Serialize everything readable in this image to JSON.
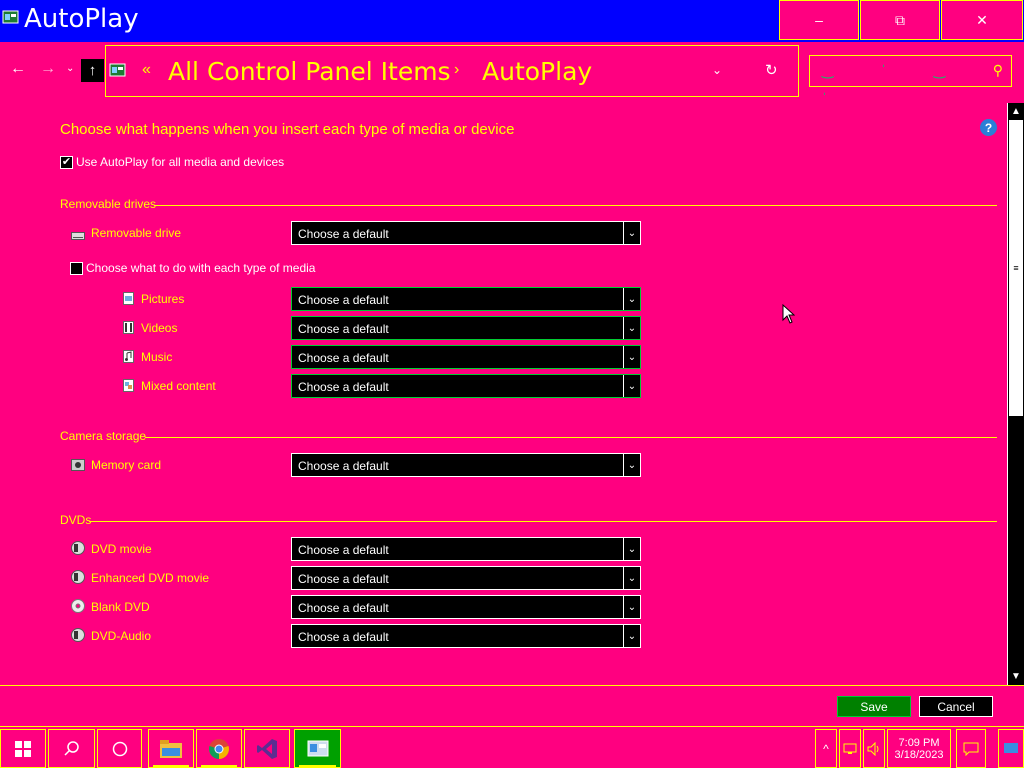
{
  "window": {
    "title": "AutoPlay",
    "minimize": "–",
    "maximize": "⧉",
    "close": "✕"
  },
  "nav": {
    "back": "←",
    "forward": "→",
    "recent": "⌄",
    "up": "↑",
    "chevron": "«",
    "crumbs": [
      "All Control Panel Items",
      "AutoPlay"
    ],
    "separator": "›",
    "dropdown": "⌄",
    "refresh": "↻",
    "search_icon": "⚲"
  },
  "content": {
    "heading": "Choose what happens when you insert each type of media or device",
    "help": "?",
    "use_autoplay": {
      "label": "Use AutoPlay for all media and devices",
      "checked": true,
      "mark": "✔"
    },
    "sections": {
      "removable": {
        "title": "Removable drives"
      },
      "camera": {
        "title": "Camera storage"
      },
      "dvds": {
        "title": "DVDs"
      }
    },
    "removable_drive": {
      "label": "Removable drive",
      "value": "Choose a default"
    },
    "each_media": {
      "label": "Choose what to do with each type of media",
      "checked": false
    },
    "media": [
      {
        "label": "Pictures",
        "value": "Choose a default",
        "icon": "pictures-icon"
      },
      {
        "label": "Videos",
        "value": "Choose a default",
        "icon": "videos-icon"
      },
      {
        "label": "Music",
        "value": "Choose a default",
        "icon": "music-icon"
      },
      {
        "label": "Mixed content",
        "value": "Choose a default",
        "icon": "mixed-content-icon"
      }
    ],
    "memory_card": {
      "label": "Memory card",
      "value": "Choose a default"
    },
    "dvd": [
      {
        "label": "DVD movie",
        "value": "Choose a default"
      },
      {
        "label": "Enhanced DVD movie",
        "value": "Choose a default"
      },
      {
        "label": "Blank DVD",
        "value": "Choose a default"
      },
      {
        "label": "DVD-Audio",
        "value": "Choose a default"
      }
    ],
    "dropdown_arrow": "⌄"
  },
  "scrollbar": {
    "up": "▲",
    "down": "▼",
    "grip": "≡"
  },
  "footer": {
    "save": "Save",
    "cancel": "Cancel"
  },
  "taskbar": {
    "time": "7:09 PM",
    "date": "3/18/2023",
    "tray_chevron": "^",
    "volume": "🔊"
  },
  "colors": {
    "background": "#ff0080",
    "titlebar": "#0000ff",
    "accent": "#ffff00",
    "save": "#008000"
  }
}
